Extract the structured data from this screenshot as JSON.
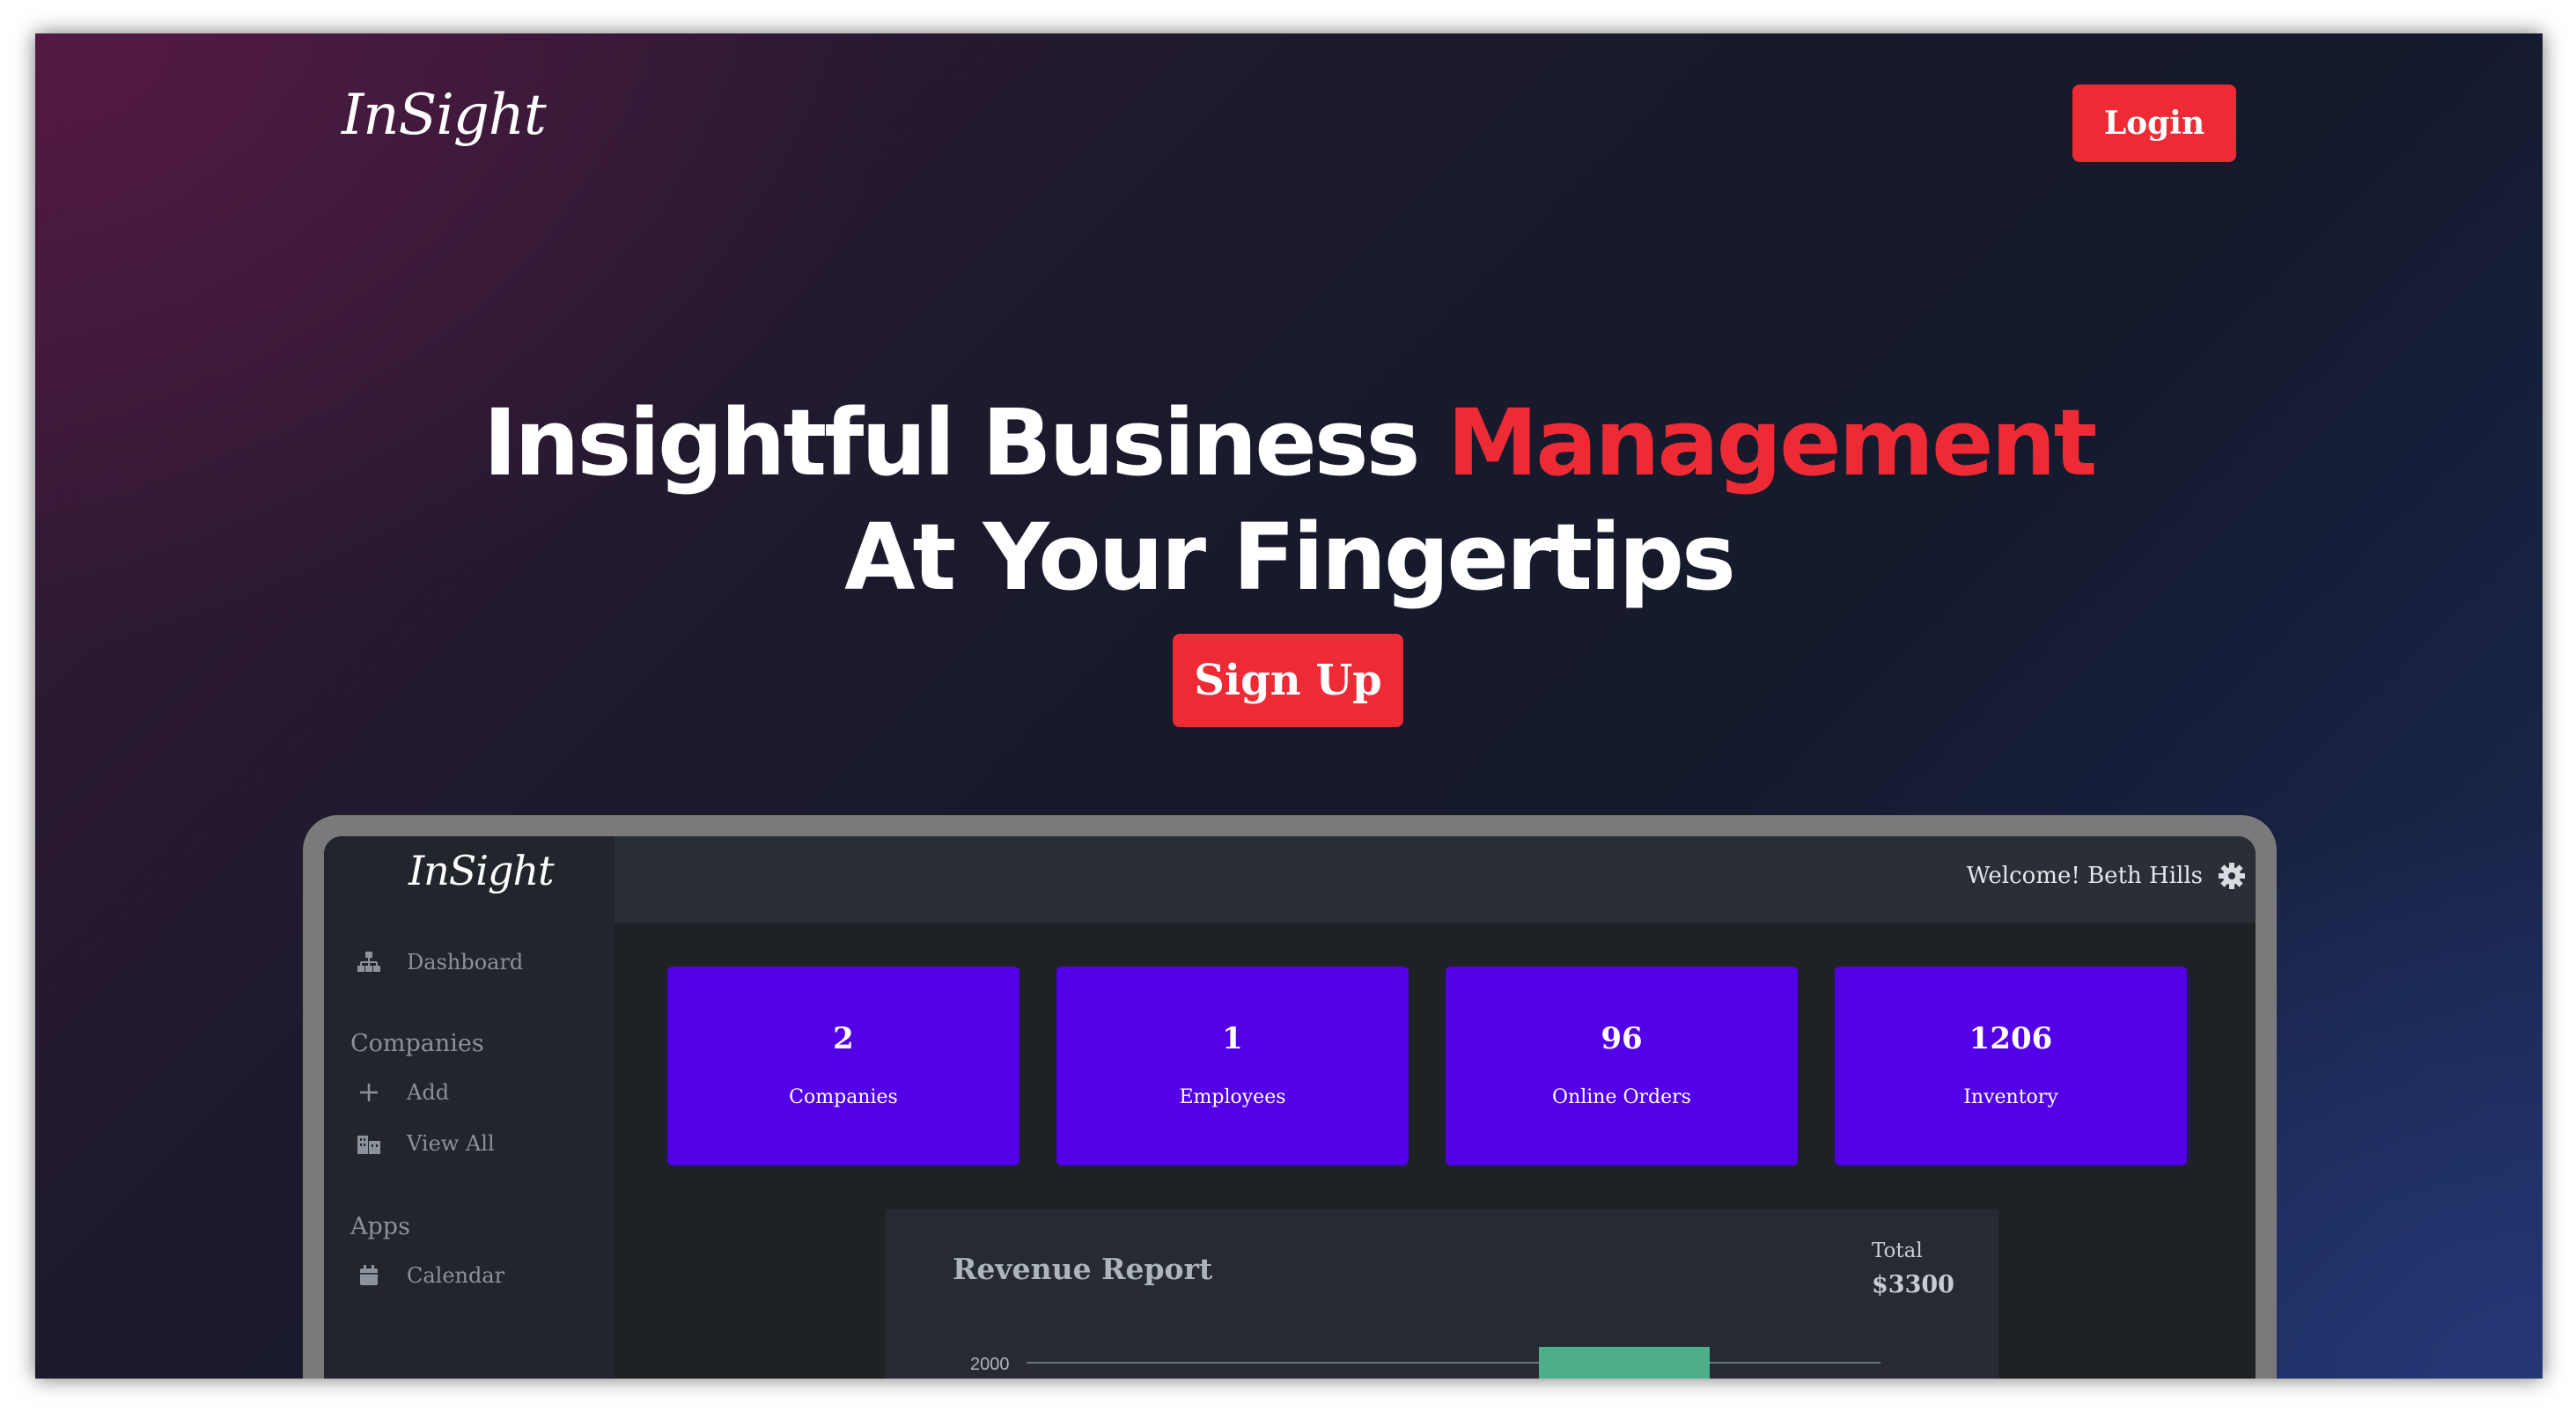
{
  "header": {
    "brand": "InSight",
    "login_label": "Login"
  },
  "hero": {
    "headline_part1": "Insightful Business ",
    "headline_accent": "Management",
    "headline_line2": "At Your Fingertips",
    "signup_label": "Sign Up"
  },
  "colors": {
    "accent_red": "#ee2a35",
    "card_purple": "#5200e8",
    "bar_green": "#4caf8a"
  },
  "app": {
    "brand": "InSight",
    "welcome": "Welcome! Beth Hills",
    "sidebar": {
      "dashboard": {
        "label": "Dashboard",
        "icon": "sitemap-icon"
      },
      "companies_heading": "Companies",
      "add": {
        "label": "Add",
        "icon": "plus-icon"
      },
      "view_all": {
        "label": "View All",
        "icon": "building-icon"
      },
      "apps_heading": "Apps",
      "calendar": {
        "label": "Calendar",
        "icon": "calendar-icon"
      }
    },
    "cards": [
      {
        "value": "2",
        "label": "Companies"
      },
      {
        "value": "1",
        "label": "Employees"
      },
      {
        "value": "96",
        "label": "Online Orders"
      },
      {
        "value": "1206",
        "label": "Inventory"
      }
    ],
    "report": {
      "title": "Revenue Report",
      "total_label": "Total",
      "total_value": "$3300"
    }
  },
  "chart_data": {
    "type": "bar",
    "title": "Revenue Report",
    "y_ticks": [
      "2000"
    ],
    "values_visible": [
      2000
    ],
    "note_partial": "chart cropped; one bar visible reaching the 2000 gridline"
  }
}
